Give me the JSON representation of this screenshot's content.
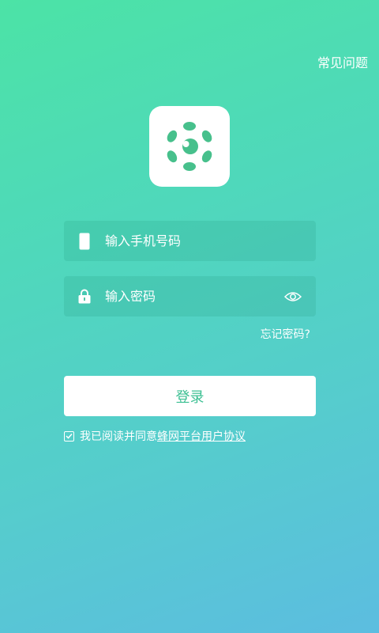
{
  "header": {
    "faq_label": "常见问题"
  },
  "logo": {
    "icon": "flower-gear-logo-icon",
    "color": "#47c08c"
  },
  "form": {
    "phone_placeholder": "输入手机号码",
    "phone_value": "",
    "phone_icon": "phone-icon",
    "password_placeholder": "输入密码",
    "password_value": "",
    "password_icon": "lock-icon",
    "visibility_icon": "eye-icon",
    "forgot_label": "忘记密码?",
    "login_label": "登录"
  },
  "agreement": {
    "checked": true,
    "text": "我已阅读并同意",
    "link_label": "蜂网平台用户协议"
  },
  "colors": {
    "gradient_top": "#4ce3a6",
    "gradient_bottom": "#5cbde0",
    "accent": "#3bbf92"
  }
}
